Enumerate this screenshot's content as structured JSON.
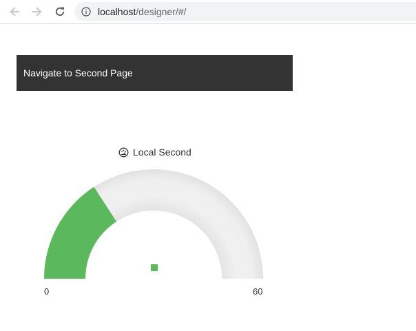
{
  "browser": {
    "back_icon": "arrow-left-icon",
    "forward_icon": "arrow-right-icon",
    "reload_icon": "reload-icon",
    "info_icon": "info-circle-icon",
    "url_host": "localhost",
    "url_path": "/designer/#/"
  },
  "page": {
    "nav_button_label": "Navigate to Second Page",
    "gauge": {
      "title": "Local Second",
      "title_icon": "gauge-icon",
      "min_label": "0",
      "max_label": "60",
      "min": 0,
      "max": 60,
      "value": 19,
      "fill_color": "#5cb85c",
      "track_color": "#eeeeee"
    }
  }
}
